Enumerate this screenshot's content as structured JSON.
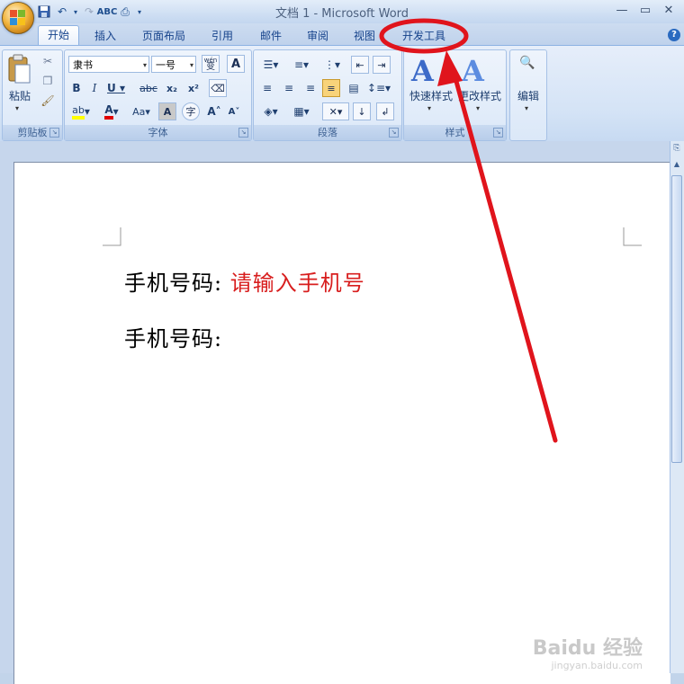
{
  "window": {
    "title": "文档 1 - Microsoft Word",
    "controls": [
      "—",
      "▭",
      "✕"
    ]
  },
  "tabs": [
    {
      "label": "开始",
      "active": true
    },
    {
      "label": "插入"
    },
    {
      "label": "页面布局"
    },
    {
      "label": "引用"
    },
    {
      "label": "邮件"
    },
    {
      "label": "审阅"
    },
    {
      "label": "视图"
    },
    {
      "label": "开发工具",
      "highlighted": true
    }
  ],
  "ribbon": {
    "clipboard": {
      "label": "剪贴板",
      "paste": "粘贴"
    },
    "font": {
      "label": "字体",
      "font_name": "隶书",
      "font_size": "一号",
      "wen": "wén",
      "wen_char": "变"
    },
    "paragraph": {
      "label": "段落"
    },
    "styles": {
      "label": "样式",
      "quick_styles": "快速样式",
      "change_styles": "更改样式"
    },
    "editing": {
      "label": "编辑"
    }
  },
  "document": {
    "line1_label": "手机号码:",
    "line1_placeholder": "请输入手机号",
    "line2_label": "手机号码:"
  },
  "watermark": {
    "brand": "Baidu 经验",
    "url": "jingyan.baidu.com"
  },
  "colors": {
    "placeholder": "#d81e1e",
    "annotation": "#e0141c",
    "ribbon_text": "#15428b"
  }
}
